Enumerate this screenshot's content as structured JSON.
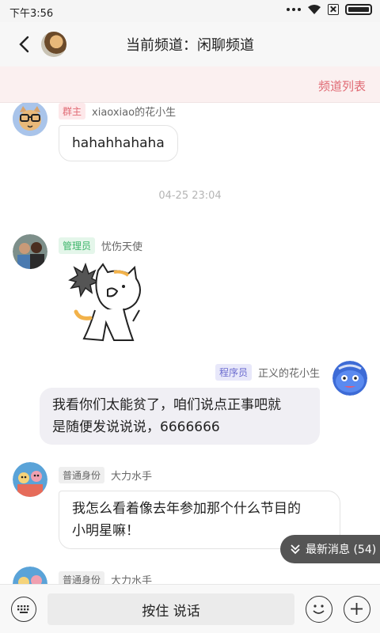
{
  "status": {
    "time": "下午3:56"
  },
  "header": {
    "title": "当前频道：闲聊频道"
  },
  "channel_bar": {
    "list_label": "频道列表"
  },
  "messages": [
    {
      "role": "群主",
      "name": "xiaoxiao的花小生",
      "text": "hahahhahaha",
      "avatar": "cat-glasses-avatar"
    },
    {
      "role": "管理员",
      "name": "忧伤天使",
      "avatar": "couple-photo-avatar",
      "sticker": "cat-sticker"
    },
    {
      "role": "程序员",
      "name": "正义的花小生",
      "text": "我看你们太能贫了，咱们说点正事吧就是随便发说说说，6666666",
      "text_line1": "我看你们太能贫了，咱们说点正事吧就",
      "text_line2": "是随便发说说说，6666666",
      "avatar": "blue-blob-avatar"
    },
    {
      "role": "普通身份",
      "name": "大力水手",
      "text": "我怎么看着像去年参加那个什么节目的小明星嘛！",
      "text_line1": "我怎么看着像去年参加那个什么节目的",
      "text_line2": "小明星嘛！",
      "avatar": "cartoon-group-avatar"
    },
    {
      "role": "普通身份",
      "name": "大力水手",
      "avatar": "cartoon-group-avatar"
    }
  ],
  "time_separator": "04-25 23:04",
  "new_messages": {
    "label": "最新消息 (54)"
  },
  "bottom_bar": {
    "hold_to_talk": "按住 说话"
  }
}
